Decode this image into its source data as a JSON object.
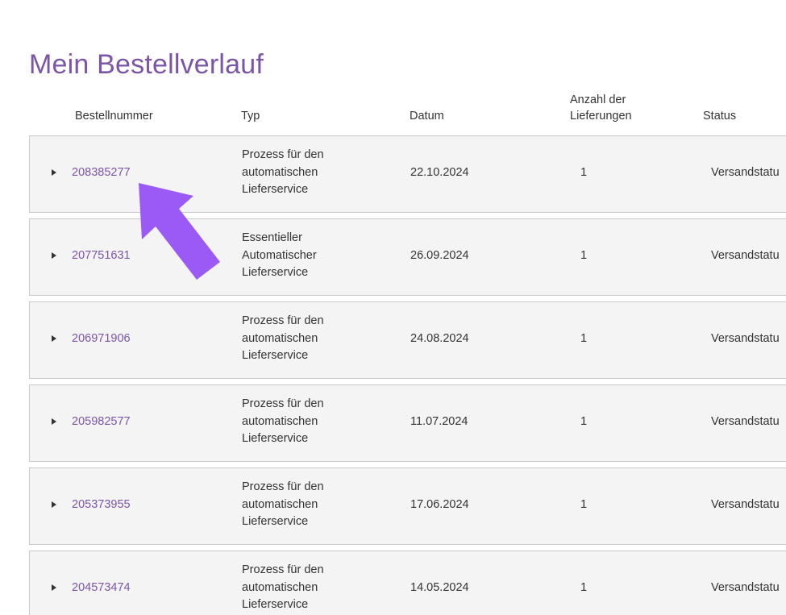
{
  "page": {
    "title": "Mein Bestellverlauf"
  },
  "table": {
    "headers": {
      "order_number": "Bestellnummer",
      "type": "Typ",
      "date": "Datum",
      "deliveries": "Anzahl der\nLieferungen",
      "status": "Status"
    },
    "rows": [
      {
        "order_number": "208385277",
        "type": "Prozess für den\nautomatischen\nLieferservice",
        "date": "22.10.2024",
        "deliveries": "1",
        "status": "Versandstatu"
      },
      {
        "order_number": "207751631",
        "type": "Essentieller\nAutomatischer\nLieferservice",
        "date": "26.09.2024",
        "deliveries": "1",
        "status": "Versandstatu"
      },
      {
        "order_number": "206971906",
        "type": "Prozess für den\nautomatischen\nLieferservice",
        "date": "24.08.2024",
        "deliveries": "1",
        "status": "Versandstatu"
      },
      {
        "order_number": "205982577",
        "type": "Prozess für den\nautomatischen\nLieferservice",
        "date": "11.07.2024",
        "deliveries": "1",
        "status": "Versandstatu"
      },
      {
        "order_number": "205373955",
        "type": "Prozess für den\nautomatischen\nLieferservice",
        "date": "17.06.2024",
        "deliveries": "1",
        "status": "Versandstatu"
      },
      {
        "order_number": "204573474",
        "type": "Prozess für den\nautomatischen\nLieferservice",
        "date": "14.05.2024",
        "deliveries": "1",
        "status": "Versandstatu"
      }
    ]
  },
  "icons": {
    "row_expand": "caret-right-icon",
    "annotation": "arrow-pointer-icon"
  },
  "colors": {
    "accent": "#7b55a8",
    "annotation_arrow": "#9b59f5",
    "row_background": "#f4f4f4",
    "row_border": "#c9c9c9",
    "text": "#333333"
  }
}
